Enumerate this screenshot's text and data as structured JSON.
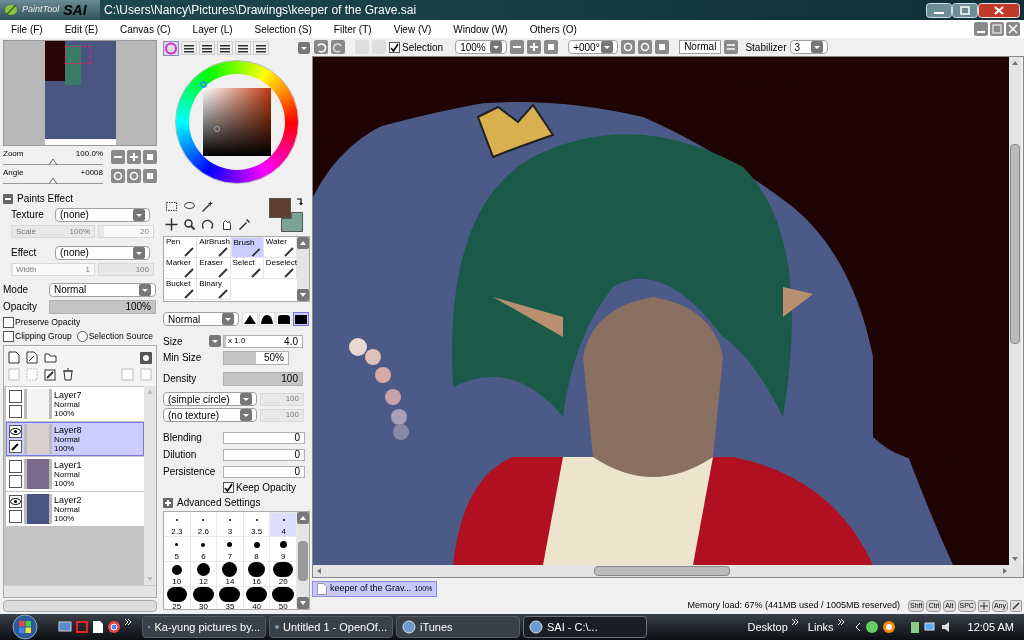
{
  "window": {
    "logo_prefix": "PaintTool",
    "logo": "SAI",
    "path": "C:\\Users\\Nancy\\Pictures\\Drawings\\keeper of the Grave.sai"
  },
  "menu": [
    "File (F)",
    "Edit (E)",
    "Canvas (C)",
    "Layer (L)",
    "Selection (S)",
    "Filter (T)",
    "View (V)",
    "Window (W)",
    "Others (O)"
  ],
  "navigator": {
    "zoom": {
      "label": "Zoom",
      "value": "100.0%",
      "level": 0.5
    },
    "angle": {
      "label": "Angle",
      "value": "+0008",
      "level": 0.5
    }
  },
  "paints_effect": {
    "title": "Paints Effect",
    "expanded": true,
    "texture_label": "Texture",
    "texture": "(none)",
    "scale": {
      "label": "Scale",
      "value": "100%",
      "level": 1
    },
    "scale_amount": {
      "value": "20",
      "level": 0.1
    },
    "effect_label": "Effect",
    "effect": "(none)",
    "width": {
      "label": "Width",
      "value": "1",
      "level": 0.01
    },
    "width_amount": {
      "value": "100",
      "level": 1
    }
  },
  "mode": {
    "label": "Mode",
    "value": "Normal"
  },
  "opacity": {
    "label": "Opacity",
    "value": "100%",
    "level": 1
  },
  "options": [
    {
      "kind": "checkbox",
      "label": "Preserve Opacity",
      "checked": false
    },
    {
      "kind": "checkbox",
      "label": "Clipping Group",
      "checked": false
    },
    {
      "kind": "radio",
      "label": "Selection Source",
      "checked": false
    }
  ],
  "layers": [
    {
      "name": "Layer7",
      "mode": "Normal",
      "opacity": "100%",
      "visible": false,
      "selected": false,
      "color": "#f4f4f4"
    },
    {
      "name": "Layer8",
      "mode": "Normal",
      "opacity": "100%",
      "visible": true,
      "selected": true,
      "color": "#d8d0d0"
    },
    {
      "name": "Layer1",
      "mode": "Normal",
      "opacity": "100%",
      "visible": false,
      "selected": false,
      "color": "#7a6a8a"
    },
    {
      "name": "Layer2",
      "mode": "Normal",
      "opacity": "100%",
      "visible": true,
      "selected": false,
      "color": "#4a5680"
    }
  ],
  "swatches": [
    {
      "kind": "primary",
      "color": "#5e3c32"
    },
    {
      "kind": "secondary",
      "color": "#7aa595"
    }
  ],
  "brush_tools": [
    {
      "label": "Pen",
      "selected": false
    },
    {
      "label": "AirBrush",
      "selected": false
    },
    {
      "label": "Brush",
      "selected": true
    },
    {
      "label": "Water",
      "selected": false
    },
    {
      "label": "Marker",
      "selected": false
    },
    {
      "label": "Eraser",
      "selected": false
    },
    {
      "label": "Select",
      "selected": false
    },
    {
      "label": "Deselect",
      "selected": false
    },
    {
      "label": "Bucket",
      "selected": false
    },
    {
      "label": "Binary",
      "selected": false
    }
  ],
  "brush": {
    "blend": "Normal",
    "edges": [
      {
        "selected": false
      },
      {
        "selected": false
      },
      {
        "selected": false
      },
      {
        "selected": true
      }
    ],
    "size": {
      "label": "Size",
      "multiplier": "x 1.0",
      "value": "4.0",
      "level": 0.02
    },
    "min_size": {
      "label": "Min Size",
      "value": "50%",
      "level": 0.5
    },
    "density": {
      "label": "Density",
      "value": "100",
      "level": 1
    },
    "shape": "(simple circle)",
    "shape_amount": {
      "value": "100",
      "level": 1
    },
    "texture": "(no texture)",
    "texture_amount": {
      "value": "100",
      "level": 1
    },
    "params": [
      {
        "label": "Blending",
        "value": "0",
        "level": 0
      },
      {
        "label": "Dilution",
        "value": "0",
        "level": 0
      },
      {
        "label": "Persistence",
        "value": "0",
        "level": 0
      }
    ],
    "keep_opacity": {
      "label": "Keep Opacity",
      "checked": true
    },
    "advanced": "Advanced Settings"
  },
  "brush_sizes": [
    {
      "label": "2.3",
      "selected": false
    },
    {
      "label": "2.6",
      "selected": false
    },
    {
      "label": "3",
      "selected": false
    },
    {
      "label": "3.5",
      "selected": false
    },
    {
      "label": "4",
      "selected": true
    },
    {
      "label": "5",
      "selected": false
    },
    {
      "label": "6",
      "selected": false
    },
    {
      "label": "7",
      "selected": false
    },
    {
      "label": "8",
      "selected": false
    },
    {
      "label": "9",
      "selected": false
    },
    {
      "label": "10",
      "selected": false
    },
    {
      "label": "12",
      "selected": false
    },
    {
      "label": "14",
      "selected": false
    },
    {
      "label": "16",
      "selected": false
    },
    {
      "label": "20",
      "selected": false
    },
    {
      "label": "25",
      "selected": false
    },
    {
      "label": "30",
      "selected": false
    },
    {
      "label": "35",
      "selected": false
    },
    {
      "label": "40",
      "selected": false
    },
    {
      "label": "50",
      "selected": false
    }
  ],
  "toolbar": {
    "selection_label": "Selection",
    "selection_checked": true,
    "zoom": "100%",
    "angle": "+000°",
    "blend": "Normal",
    "stabilizer_label": "Stabilizer",
    "stabilizer": "3"
  },
  "document_tabs": [
    {
      "title": "keeper of the Grav...",
      "zoom": "100%",
      "selected": true
    }
  ],
  "status": {
    "memory": "Memory load: 67% (441MB used / 1005MB reserved)",
    "keys": [
      "Shft",
      "Ctrl",
      "Alt",
      "SPC"
    ],
    "any_key": "Any"
  },
  "taskbar": {
    "tasks": [
      {
        "label": "Ka-yung pictures by...",
        "selected": false
      },
      {
        "label": "Untitled 1 - OpenOf...",
        "selected": false
      },
      {
        "label": "iTunes",
        "selected": false
      },
      {
        "label": "SAI - C:\\...",
        "selected": true
      }
    ],
    "toolbars": [
      "Desktop",
      "Links"
    ],
    "clock": "12:05 AM"
  }
}
